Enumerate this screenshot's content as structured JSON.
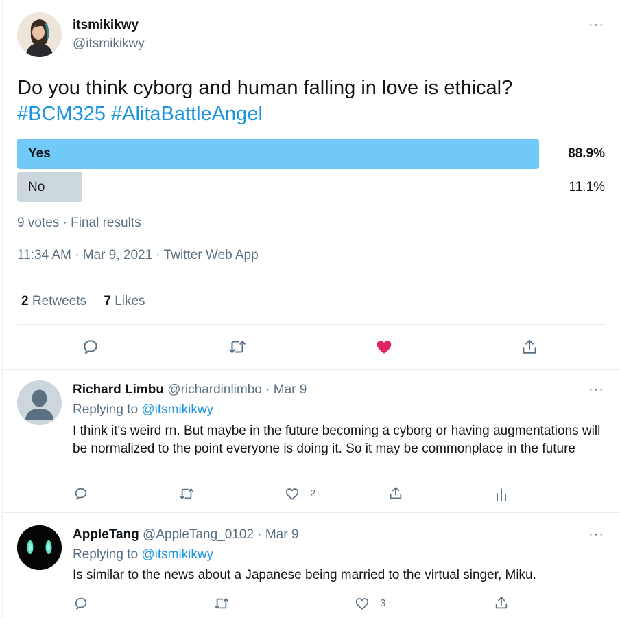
{
  "tweet": {
    "display_name": "itsmikikwy",
    "handle": "@itsmikikwy",
    "text": "Do you think cyborg and human falling in love is ethical?",
    "hashtags": "#BCM325 #AlitaBattleAngel",
    "poll": {
      "options": [
        {
          "label": "Yes",
          "percent_text": "88.9%",
          "percent": 88.9,
          "winner": true
        },
        {
          "label": "No",
          "percent_text": "11.1%",
          "percent": 11.1,
          "winner": false
        }
      ],
      "summary": "9 votes · Final results"
    },
    "timestamp": "11:34 AM · Mar 9, 2021 · Twitter Web App",
    "retweets_count": "2",
    "retweets_label": "Retweets",
    "likes_count": "7",
    "likes_label": "Likes",
    "actions": [
      "reply-icon",
      "retweet-icon",
      "like-icon-filled",
      "share-icon"
    ]
  },
  "replies": [
    {
      "display_name": "Richard Limbu",
      "meta": "@richardinlimbo · Mar 9",
      "replying_prefix": "Replying to",
      "replying_to": "@itsmikikwy",
      "text": "I think it's weird rn. But maybe in the future becoming a cyborg or having augmentations will be normalized to the point everyone is doing it. So it may be commonplace in the future",
      "like_count": "2",
      "actions": [
        "reply-icon",
        "retweet-icon",
        "like-icon",
        "share-icon",
        "analytics-icon"
      ]
    },
    {
      "display_name": "AppleTang",
      "meta": "@AppleTang_0102 · Mar 9",
      "replying_prefix": "Replying to",
      "replying_to": "@itsmikikwy",
      "text": "Is similar to the news about a Japanese being married to the virtual singer, Miku.",
      "like_count": "3",
      "actions": [
        "reply-icon",
        "retweet-icon",
        "like-icon",
        "share-icon"
      ]
    }
  ],
  "more_glyph": "···",
  "colors": {
    "accent": "#1b95e0",
    "poll_winner": "#71c9f8",
    "poll_other": "#ccd6dd",
    "like_red": "#e0245e",
    "muted": "#5b7083"
  }
}
